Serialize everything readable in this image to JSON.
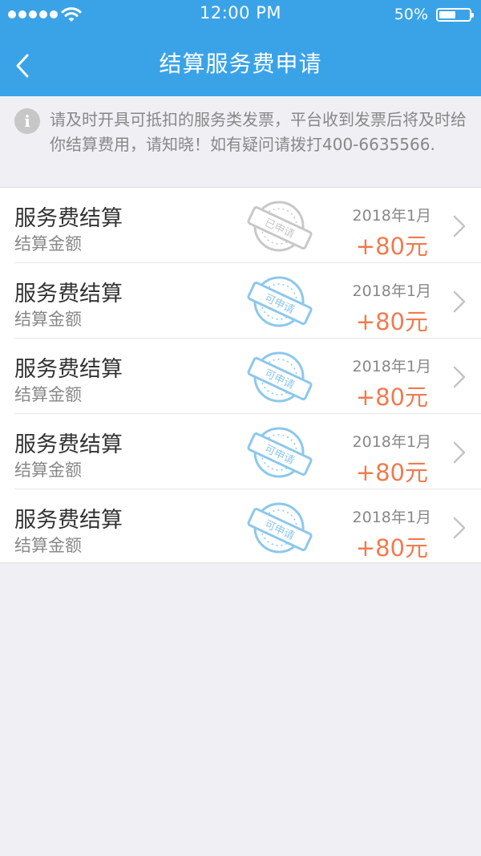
{
  "status_bar": {
    "time": "12:00 PM",
    "battery": "50%"
  },
  "header": {
    "title": "结算服务费申请"
  },
  "notice": {
    "text": "请及时开具可抵扣的服务类发票，平台收到发票后将及时给你结算费用，请知晓！如有疑问请拨打400-6635566."
  },
  "items": [
    {
      "title": "服务费结算",
      "subtitle": "结算金额",
      "date": "2018年1月",
      "amount": "+80元",
      "stamp": "已申请",
      "stamp_color": "#c8c8c8"
    },
    {
      "title": "服务费结算",
      "subtitle": "结算金额",
      "date": "2018年1月",
      "amount": "+80元",
      "stamp": "可申请",
      "stamp_color": "#8cc8ec"
    },
    {
      "title": "服务费结算",
      "subtitle": "结算金额",
      "date": "2018年1月",
      "amount": "+80元",
      "stamp": "可申请",
      "stamp_color": "#8cc8ec"
    },
    {
      "title": "服务费结算",
      "subtitle": "结算金额",
      "date": "2018年1月",
      "amount": "+80元",
      "stamp": "可申请",
      "stamp_color": "#8cc8ec"
    },
    {
      "title": "服务费结算",
      "subtitle": "结算金额",
      "date": "2018年1月",
      "amount": "+80元",
      "stamp": "可申请",
      "stamp_color": "#8cc8ec"
    }
  ],
  "colors": {
    "brand": "#3aa3e8",
    "amount": "#f07b4f"
  }
}
